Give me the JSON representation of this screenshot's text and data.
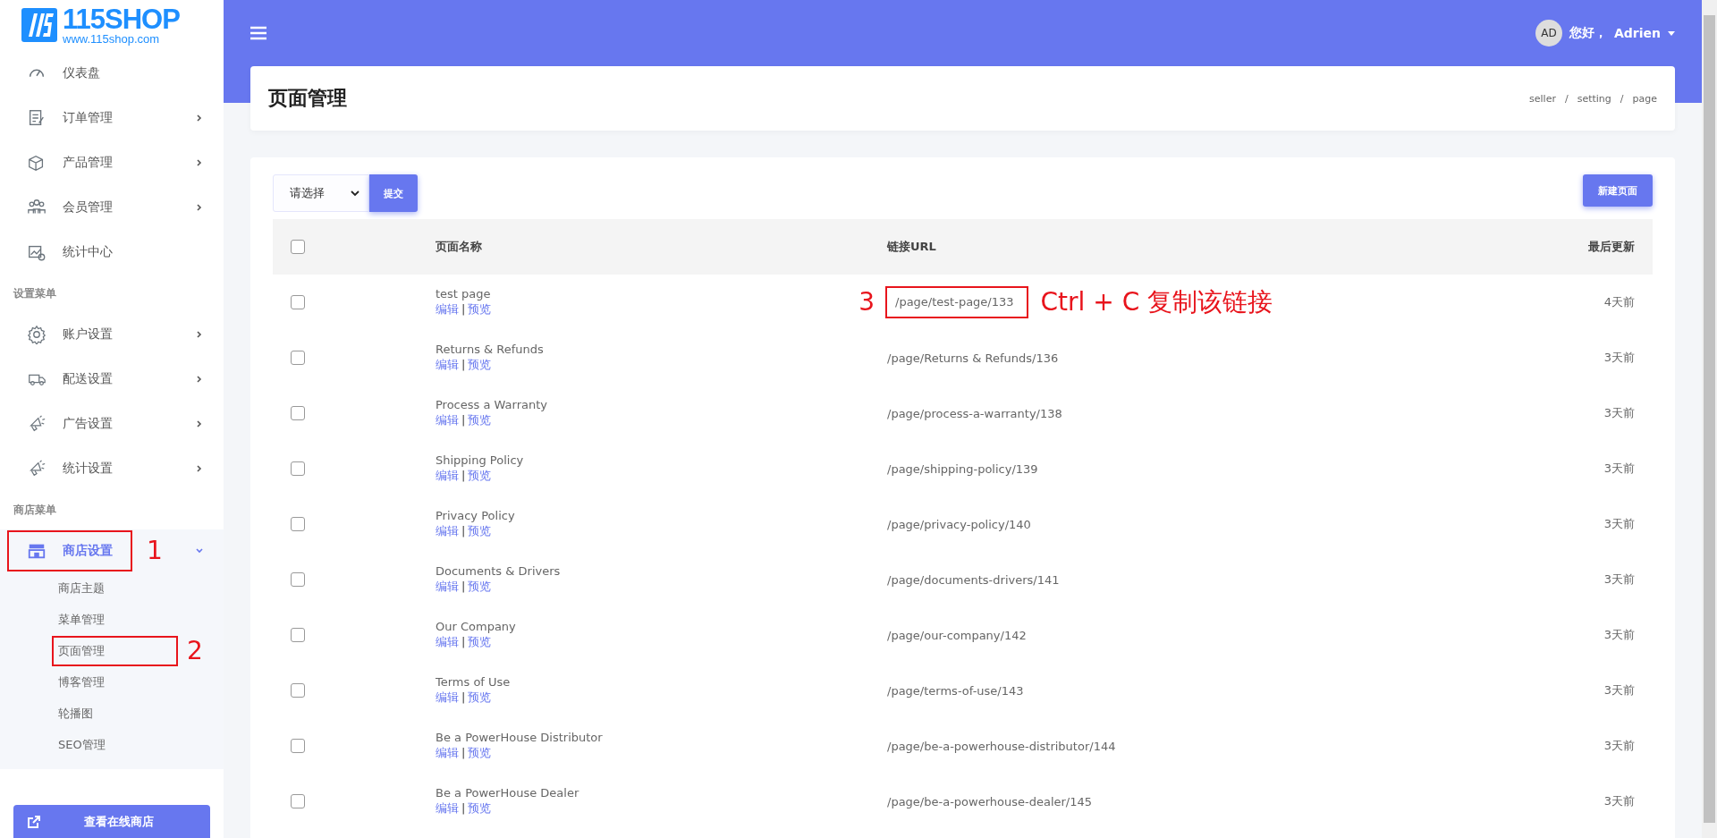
{
  "logo": {
    "title": "115SHOP",
    "url": "www.115shop.com"
  },
  "sidebar": {
    "groups": [
      {
        "items": [
          {
            "label": "仪表盘",
            "expandable": false,
            "selected": false
          },
          {
            "label": "订单管理",
            "expandable": true,
            "expanded": false,
            "selected": false
          },
          {
            "label": "产品管理",
            "expandable": true,
            "expanded": false,
            "selected": false
          },
          {
            "label": "会员管理",
            "expandable": true,
            "expanded": false,
            "selected": false
          },
          {
            "label": "统计中心",
            "expandable": false,
            "selected": false
          }
        ]
      },
      {
        "heading": "设置菜单",
        "items": [
          {
            "label": "账户设置",
            "expandable": true,
            "expanded": false,
            "selected": false
          },
          {
            "label": "配送设置",
            "expandable": true,
            "expanded": false,
            "selected": false
          },
          {
            "label": "广告设置",
            "expandable": true,
            "expanded": false,
            "selected": false
          },
          {
            "label": "统计设置",
            "expandable": true,
            "expanded": false,
            "selected": false
          }
        ]
      },
      {
        "heading": "商店菜单",
        "items": [
          {
            "label": "商店设置",
            "expandable": true,
            "expanded": true,
            "selected": true,
            "callout": "1",
            "children": [
              {
                "label": "商店主题"
              },
              {
                "label": "菜单管理"
              },
              {
                "label": "页面管理",
                "callout": "2"
              },
              {
                "label": "博客管理"
              },
              {
                "label": "轮播图"
              },
              {
                "label": "SEO管理"
              }
            ]
          }
        ]
      }
    ],
    "button": "查看在线商店"
  },
  "topbar": {
    "avatar": "AD",
    "greeting": "您好，",
    "user": "Adrien"
  },
  "header": {
    "title": "页面管理",
    "breadcrumb": [
      "seller",
      "/",
      "setting",
      "/",
      "page"
    ]
  },
  "toolbar": {
    "select_placeholder": "请选择",
    "submit": "提交",
    "new_button": "新建页面"
  },
  "table": {
    "columns": [
      "页面名称",
      "链接URL",
      "最后更新"
    ],
    "all_checked": false,
    "rows": [
      {
        "checked": false,
        "name": "test page",
        "edit": "编辑",
        "separator": "|",
        "preview": "预览",
        "url": "/page/test-page/133",
        "updated": "4天前",
        "callout": "3",
        "callout_note": "Ctrl + C 复制该链接"
      },
      {
        "checked": false,
        "name": "Returns & Refunds",
        "edit": "编辑",
        "separator": "|",
        "preview": "预览",
        "url": "/page/Returns & Refunds/136",
        "updated": "3天前"
      },
      {
        "checked": false,
        "name": "Process a Warranty",
        "edit": "编辑",
        "separator": "|",
        "preview": "预览",
        "url": "/page/process-a-warranty/138",
        "updated": "3天前"
      },
      {
        "checked": false,
        "name": "Shipping Policy",
        "edit": "编辑",
        "separator": "|",
        "preview": "预览",
        "url": "/page/shipping-policy/139",
        "updated": "3天前"
      },
      {
        "checked": false,
        "name": "Privacy Policy",
        "edit": "编辑",
        "separator": "|",
        "preview": "预览",
        "url": "/page/privacy-policy/140",
        "updated": "3天前"
      },
      {
        "checked": false,
        "name": "Documents & Drivers",
        "edit": "编辑",
        "separator": "|",
        "preview": "预览",
        "url": "/page/documents-drivers/141",
        "updated": "3天前"
      },
      {
        "checked": false,
        "name": "Our Company",
        "edit": "编辑",
        "separator": "|",
        "preview": "预览",
        "url": "/page/our-company/142",
        "updated": "3天前"
      },
      {
        "checked": false,
        "name": "Terms of Use",
        "edit": "编辑",
        "separator": "|",
        "preview": "预览",
        "url": "/page/terms-of-use/143",
        "updated": "3天前"
      },
      {
        "checked": false,
        "name": "Be a PowerHouse Distributor",
        "edit": "编辑",
        "separator": "|",
        "preview": "预览",
        "url": "/page/be-a-powerhouse-distributor/144",
        "updated": "3天前"
      },
      {
        "checked": false,
        "name": "Be a PowerHouse Dealer",
        "edit": "编辑",
        "separator": "|",
        "preview": "预览",
        "url": "/page/be-a-powerhouse-dealer/145",
        "updated": "3天前"
      }
    ]
  }
}
